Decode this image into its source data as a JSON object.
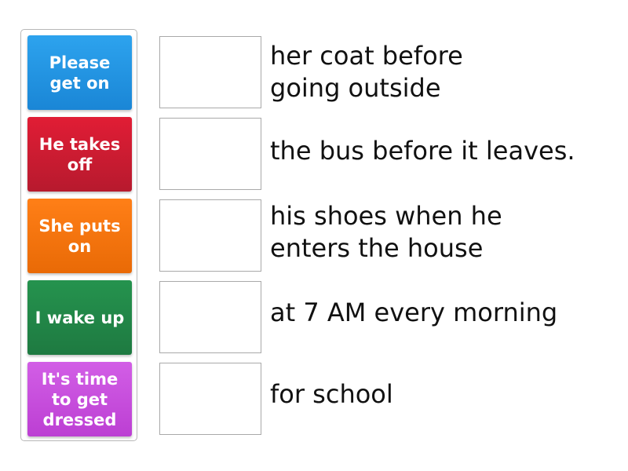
{
  "tiles": [
    {
      "label": "Please get on",
      "color_top": "#2da3ee",
      "color_bottom": "#1a86d6"
    },
    {
      "label": "He takes off",
      "color_top": "#e11d35",
      "color_bottom": "#b71a2e"
    },
    {
      "label": "She puts on",
      "color_top": "#ff7f17",
      "color_bottom": "#e96a06"
    },
    {
      "label": "I wake up",
      "color_top": "#25934e",
      "color_bottom": "#1e7a41"
    },
    {
      "label": "It's time to get dressed",
      "color_top": "#d25ee6",
      "color_bottom": "#bc3fd3"
    }
  ],
  "targets": [
    {
      "text": "her coat before\ngoing outside"
    },
    {
      "text": "the bus before it leaves."
    },
    {
      "text": "his shoes when he\nenters the house"
    },
    {
      "text": "at 7 AM every morning"
    },
    {
      "text": "for school"
    }
  ]
}
